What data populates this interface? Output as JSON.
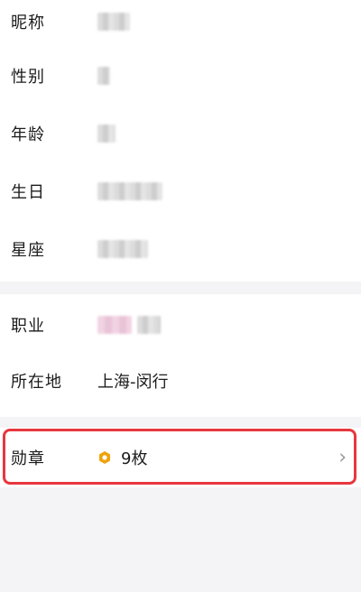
{
  "profile": {
    "rows": [
      {
        "label": "昵称"
      },
      {
        "label": "性别"
      },
      {
        "label": "年龄"
      },
      {
        "label": "生日"
      },
      {
        "label": "星座"
      }
    ],
    "job": {
      "label": "职业"
    },
    "location": {
      "label": "所在地",
      "value": "上海-闵行"
    },
    "medal": {
      "label": "勋章",
      "count": "9枚"
    }
  },
  "colors": {
    "highlight": "#e7373e",
    "medal_icon": "#f0a20b",
    "background": "#f4f4f6"
  }
}
